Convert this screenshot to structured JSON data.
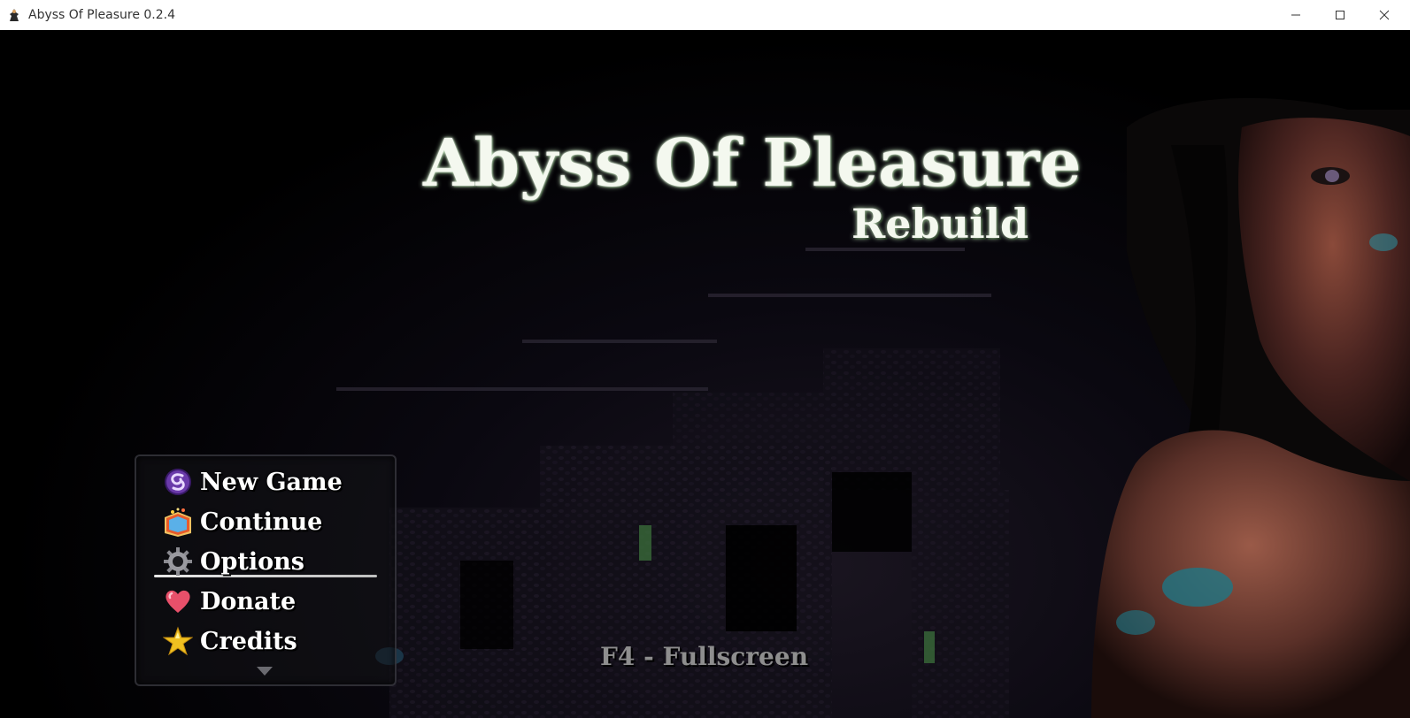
{
  "window": {
    "title": "Abyss Of Pleasure 0.2.4",
    "app_icon": "game-app-icon",
    "controls": [
      "minimize-icon",
      "maximize-icon",
      "close-icon"
    ]
  },
  "title_screen": {
    "title": "Abyss Of Pleasure",
    "subtitle": "Rebuild",
    "menu": {
      "items": [
        {
          "label": "New Game",
          "icon": "purple-swirl-icon"
        },
        {
          "label": "Continue",
          "icon": "book-icon"
        },
        {
          "label": "Options",
          "icon": "gear-icon"
        },
        {
          "label": "Donate",
          "icon": "heart-icon"
        },
        {
          "label": "Credits",
          "icon": "star-icon"
        }
      ],
      "selected_index": 1
    },
    "hint": "F4 - Fullscreen"
  },
  "colors": {
    "title_text": "#f4f8ef",
    "menu_text": "#ffffff",
    "hint_text": "#8e8e8e",
    "background": "#000000"
  }
}
